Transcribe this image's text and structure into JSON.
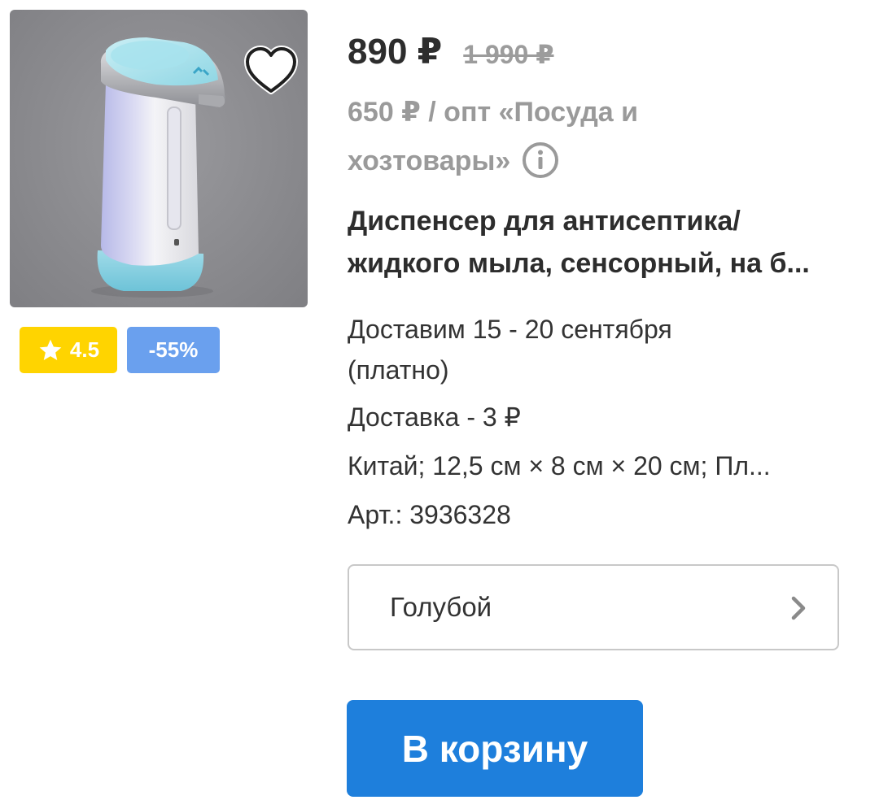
{
  "product": {
    "image_alt": "soap-dispenser-photo",
    "favorite_icon": "heart-icon"
  },
  "badges": {
    "rating": "4.5",
    "rating_icon": "star-icon",
    "discount": "-55%"
  },
  "price": {
    "current": "890 ₽",
    "old": "1 990 ₽"
  },
  "wholesale": {
    "line1": "650 ₽ / опт «Посуда и",
    "line2": "хозтовары»",
    "info_icon": "info-icon"
  },
  "title": {
    "line1": "Диспенсер для антисептика/",
    "line2": "жидкого мыла, сенсорный, на б..."
  },
  "details": {
    "delivery_line1": "Доставим 15 - 20 сентября",
    "delivery_line2": "(платно)",
    "delivery_cost": "Доставка - 3 ₽",
    "specs": "Китай; 12,5 см × 8 см × 20 см; Пл...",
    "article": "Арт.: 3936328"
  },
  "variant": {
    "selected": "Голубой",
    "icon": "chevron-right-icon"
  },
  "cart": {
    "label": "В корзину"
  },
  "colors": {
    "rating_badge": "#ffd400",
    "discount_badge": "#6aa0ee",
    "cart_button": "#1e7fdc",
    "muted_text": "#9a9a9a"
  }
}
